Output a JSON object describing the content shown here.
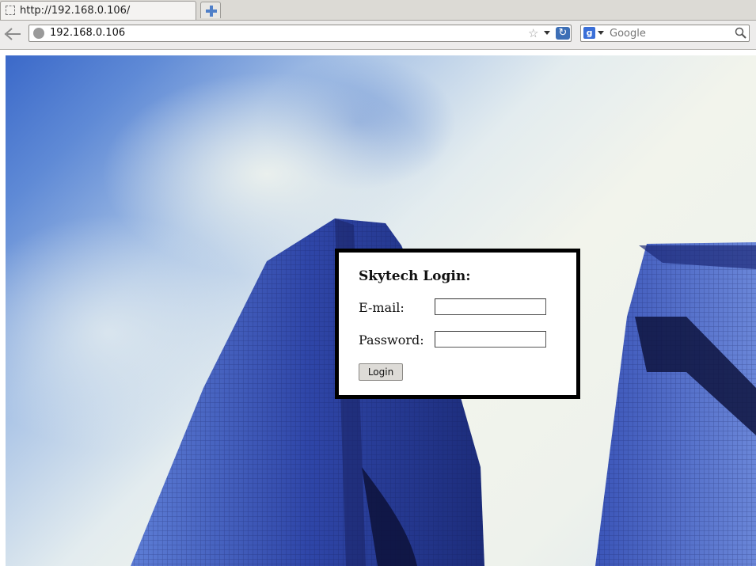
{
  "browser": {
    "tab": {
      "title": "http://192.168.0.106/"
    },
    "new_tab_icon": "plus-icon",
    "url": "192.168.0.106",
    "search": {
      "engine_icon": "google-icon",
      "placeholder": "Google"
    }
  },
  "login": {
    "heading": "Skytech Login:",
    "email_label": "E-mail:",
    "email_value": "",
    "password_label": "Password:",
    "password_value": "",
    "submit_label": "Login"
  },
  "colors": {
    "login_border": "#000000",
    "sky_blue": "#3b69c9",
    "building_blue": "#2a3f9c"
  }
}
